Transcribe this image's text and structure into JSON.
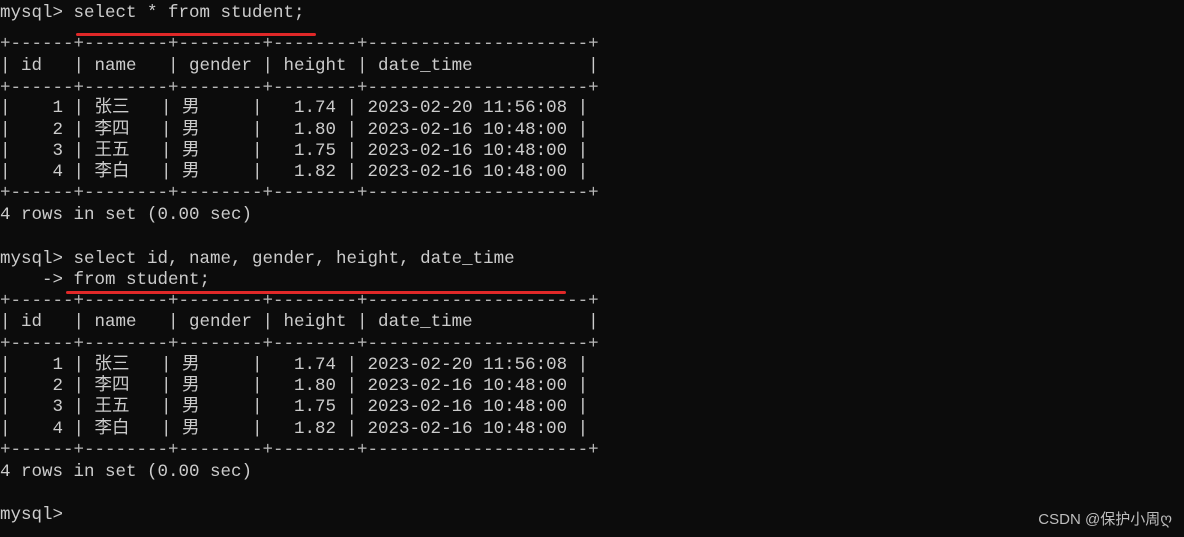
{
  "terminal": {
    "prompt": "mysql> ",
    "continuation_prompt": "    -> ",
    "queries": [
      {
        "command_lines": [
          "select * from student;"
        ],
        "columns": [
          "id",
          "name",
          "gender",
          "height",
          "date_time"
        ],
        "rows": [
          [
            "1",
            "张三",
            "男",
            "1.74",
            "2023-02-20 11:56:08"
          ],
          [
            "2",
            "李四",
            "男",
            "1.80",
            "2023-02-16 10:48:00"
          ],
          [
            "3",
            "王五",
            "男",
            "1.75",
            "2023-02-16 10:48:00"
          ],
          [
            "4",
            "李白",
            "男",
            "1.82",
            "2023-02-16 10:48:00"
          ]
        ],
        "result_summary": "4 rows in set (0.00 sec)"
      },
      {
        "command_lines": [
          "select id, name, gender, height, date_time",
          "from student;"
        ],
        "columns": [
          "id",
          "name",
          "gender",
          "height",
          "date_time"
        ],
        "rows": [
          [
            "1",
            "张三",
            "男",
            "1.74",
            "2023-02-20 11:56:08"
          ],
          [
            "2",
            "李四",
            "男",
            "1.80",
            "2023-02-16 10:48:00"
          ],
          [
            "3",
            "王五",
            "男",
            "1.75",
            "2023-02-16 10:48:00"
          ],
          [
            "4",
            "李白",
            "男",
            "1.82",
            "2023-02-16 10:48:00"
          ]
        ],
        "result_summary": "4 rows in set (0.00 sec)"
      }
    ],
    "final_prompt": "mysql>"
  },
  "annotation_color": "#e02828",
  "watermark": "CSDN @保护小周ღ"
}
